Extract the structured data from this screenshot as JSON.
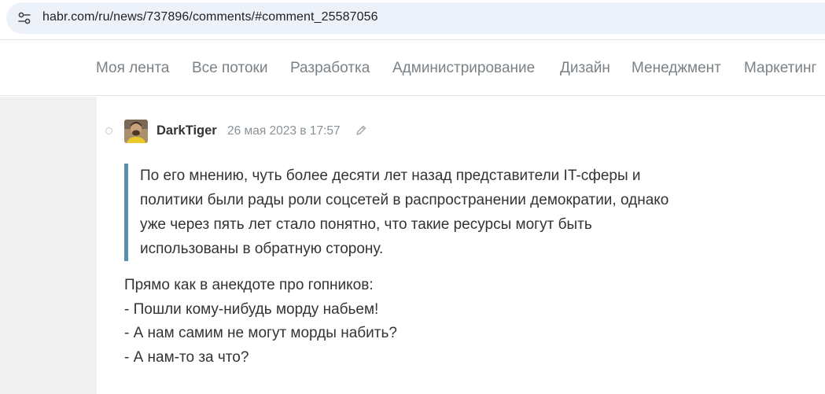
{
  "browser": {
    "url": "habr.com/ru/news/737896/comments/#comment_25587056",
    "site_icon": "site-info-tune-icon"
  },
  "nav": {
    "items": [
      {
        "label": "Моя лента"
      },
      {
        "label": "Все потоки"
      },
      {
        "label": "Разработка"
      },
      {
        "label": "Администрирование"
      },
      {
        "label": "Дизайн"
      },
      {
        "label": "Менеджмент"
      },
      {
        "label": "Маркетинг"
      }
    ]
  },
  "comment": {
    "author": "DarkTiger",
    "timestamp": "26 мая 2023 в 17:57",
    "edited_icon": "pencil-icon",
    "quote_lines": [
      "По его мнению, чуть более десяти лет назад представители IT-сферы и",
      "политики были рады роли соцсетей в распространении демократии, однако",
      "уже через пять лет стало понятно, что такие ресурсы могут быть",
      "использованы в обратную сторону."
    ],
    "body_lines": [
      "Прямо как в анекдоте про гопников:",
      "- Пошли кому-нибудь морду набьем!",
      "- А нам самим не могут морды набить?",
      "- А нам-то за что?"
    ]
  },
  "colors": {
    "quote_border": "#5e8ea6",
    "nav_text": "#7b8287",
    "text": "#333333",
    "meta_text": "#8a9197",
    "url_bar_bg": "#edf2fa"
  }
}
